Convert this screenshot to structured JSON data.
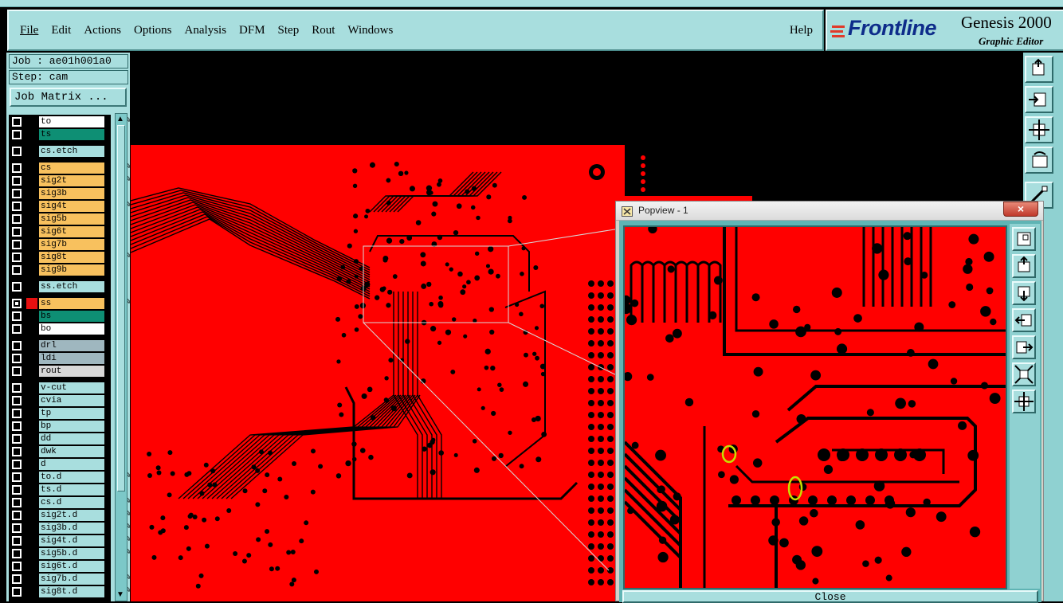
{
  "menubar": {
    "items": [
      "File",
      "Edit",
      "Actions",
      "Options",
      "Analysis",
      "DFM",
      "Step",
      "Rout",
      "Windows"
    ],
    "help": "Help"
  },
  "brand": {
    "logo_text": "Frontline",
    "product": "Genesis 2000",
    "subtitle": "Graphic Editor"
  },
  "job": {
    "job_label": "Job : ae01h001a0",
    "step_label": "Step: cam",
    "matrix_button": "Job Matrix ..."
  },
  "layers": [
    {
      "name": "to",
      "color": "#ffffff",
      "edit": true
    },
    {
      "name": "ts",
      "color": "#0e8f74",
      "edit": false
    },
    {
      "name": "cs.etch",
      "color": "#a8dede",
      "edit": false
    },
    {
      "name": "cs",
      "color": "#f8c15e",
      "edit": true
    },
    {
      "name": "sig2t",
      "color": "#f8c15e",
      "edit": true
    },
    {
      "name": "sig3b",
      "color": "#f8c15e",
      "edit": false
    },
    {
      "name": "sig4t",
      "color": "#f8c15e",
      "edit": true
    },
    {
      "name": "sig5b",
      "color": "#f8c15e",
      "edit": false
    },
    {
      "name": "sig6t",
      "color": "#f8c15e",
      "edit": false
    },
    {
      "name": "sig7b",
      "color": "#f8c15e",
      "edit": false
    },
    {
      "name": "sig8t",
      "color": "#f8c15e",
      "edit": true
    },
    {
      "name": "sig9b",
      "color": "#f8c15e",
      "edit": false
    },
    {
      "name": "ss.etch",
      "color": "#a8dede",
      "edit": false
    },
    {
      "name": "ss",
      "color": "#f8c15e",
      "edit": true,
      "active": true,
      "swatch": "#e81010"
    },
    {
      "name": "bs",
      "color": "#0e8f74",
      "edit": false
    },
    {
      "name": "bo",
      "color": "#ffffff",
      "edit": false
    },
    {
      "name": "drl",
      "color": "#9fb7bf",
      "edit": false
    },
    {
      "name": "ldi",
      "color": "#9fb7bf",
      "edit": false
    },
    {
      "name": "rout",
      "color": "#d8d8d8",
      "edit": false
    },
    {
      "name": "v-cut",
      "color": "#a8dede",
      "edit": false
    },
    {
      "name": "cvia",
      "color": "#a8dede",
      "edit": false
    },
    {
      "name": "tp",
      "color": "#a8dede",
      "edit": false
    },
    {
      "name": "bp",
      "color": "#a8dede",
      "edit": false
    },
    {
      "name": "dd",
      "color": "#a8dede",
      "edit": false
    },
    {
      "name": "dwk",
      "color": "#a8dede",
      "edit": false
    },
    {
      "name": "d",
      "color": "#a8dede",
      "edit": false
    },
    {
      "name": "to.d",
      "color": "#a8dede",
      "edit": true
    },
    {
      "name": "ts.d",
      "color": "#a8dede",
      "edit": false
    },
    {
      "name": "cs.d",
      "color": "#a8dede",
      "edit": true
    },
    {
      "name": "sig2t.d",
      "color": "#a8dede",
      "edit": true
    },
    {
      "name": "sig3b.d",
      "color": "#a8dede",
      "edit": true
    },
    {
      "name": "sig4t.d",
      "color": "#a8dede",
      "edit": true
    },
    {
      "name": "sig5b.d",
      "color": "#a8dede",
      "edit": true
    },
    {
      "name": "sig6t.d",
      "color": "#a8dede",
      "edit": false
    },
    {
      "name": "sig7b.d",
      "color": "#a8dede",
      "edit": true
    },
    {
      "name": "sig8t.d",
      "color": "#a8dede",
      "edit": true
    }
  ],
  "popview": {
    "title": "Popview - 1",
    "close_x": "×",
    "close_button": "Close"
  },
  "colors": {
    "copper": "#ff0000",
    "background": "#000000",
    "panel": "#a8dede",
    "highlight_marker": "#c8e000"
  },
  "icons": {
    "right_toolbar": [
      "zoom-home-icon",
      "zoom-in-icon",
      "zoom-fit-icon",
      "measure-icon",
      "draw-icon"
    ],
    "popview_toolbar": [
      "zoom-window-icon",
      "zoom-home-icon",
      "pan-down-icon",
      "pan-left-icon",
      "pan-right-icon",
      "zoom-out-icon",
      "zoom-fit-icon"
    ]
  }
}
